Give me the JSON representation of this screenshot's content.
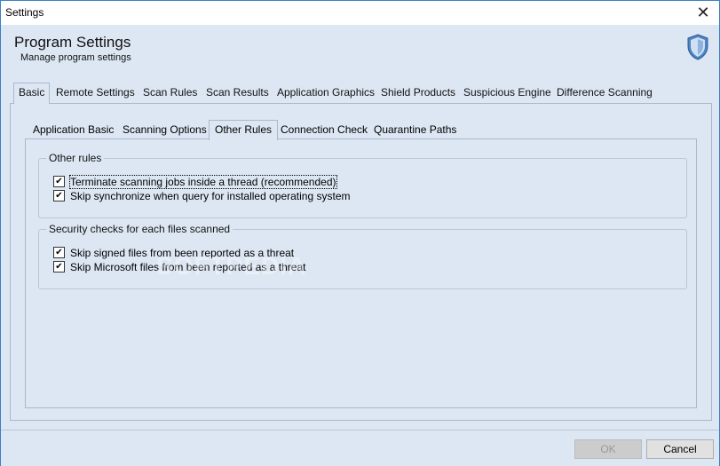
{
  "window": {
    "title": "Settings"
  },
  "header": {
    "title": "Program Settings",
    "subtitle": "Manage program settings"
  },
  "main_tabs": [
    {
      "label": "Basic",
      "selected": true
    },
    {
      "label": "Remote Settings"
    },
    {
      "label": "Scan Rules"
    },
    {
      "label": "Scan Results"
    },
    {
      "label": "Application Graphics"
    },
    {
      "label": "Shield Products"
    },
    {
      "label": "Suspicious Engine"
    },
    {
      "label": "Difference Scanning"
    }
  ],
  "sub_tabs": [
    {
      "label": "Application Basic"
    },
    {
      "label": "Scanning Options"
    },
    {
      "label": "Other Rules",
      "selected": true
    },
    {
      "label": "Connection Check"
    },
    {
      "label": "Quarantine Paths"
    }
  ],
  "groups": [
    {
      "legend": "Other rules",
      "items": [
        {
          "label": "Terminate scanning jobs inside a thread (recommended)",
          "checked": true
        },
        {
          "label": "Skip synchronize when query for installed operating system",
          "checked": true
        }
      ]
    },
    {
      "legend": "Security checks for each files scanned",
      "items": [
        {
          "label": "Skip signed files from been reported as a threat",
          "checked": true
        },
        {
          "label": "Skip Microsoft files from been reported as a threat",
          "checked": true
        }
      ]
    }
  ],
  "watermark": "SOFTPEDIA",
  "buttons": {
    "ok": "OK",
    "cancel": "Cancel"
  },
  "icons": {
    "close": "close-icon",
    "shield": "shield-icon"
  }
}
